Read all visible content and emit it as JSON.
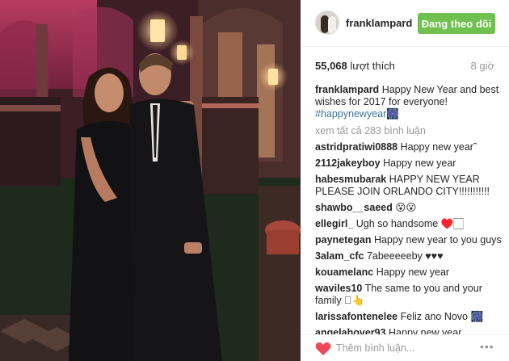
{
  "post": {
    "photo_alt": "Photo"
  },
  "header": {
    "username": "franklampard",
    "follow_label": "Đang theo dõi"
  },
  "stats": {
    "likes_count": "55,068",
    "likes_label": "lượt thích",
    "time_ago": "8 giờ"
  },
  "caption": {
    "username": "franklampard",
    "text": "Happy New Year and best wishes for 2017 for everyone!",
    "hashtag": "#happynewyear",
    "emoji": "🎆"
  },
  "view_all_label": "xem tất cả 283 bình luận",
  "comments": [
    {
      "user": "astridpratiwi0888",
      "text": "Happy new year˜"
    },
    {
      "user": "2112jakeyboy",
      "text": "Happy new year"
    },
    {
      "user": "habesmubarak",
      "text": "HAPPY NEW YEAR PLEASE JOIN ORLANDO CITY!!!!!!!!!!!"
    },
    {
      "user": "shawbo__saeed",
      "text": "😮😮"
    },
    {
      "user": "ellegirl_",
      "text": "Ugh so handsome ♥️🏻"
    },
    {
      "user": "paynetegan",
      "text": "Happy new year to you guys"
    },
    {
      "user": "3alam_cfc",
      "text": "7abeeeeeby ♥♥♥"
    },
    {
      "user": "kouamelanc",
      "text": "Happy new year"
    },
    {
      "user": "waviles10",
      "text": "The same to you and your family 🏻👆"
    },
    {
      "user": "larissafontenelee",
      "text": "Feliz ano Novo 🎆"
    },
    {
      "user": "angelahover93",
      "text": "Happy new year"
    }
  ],
  "add_comment": {
    "placeholder": "Thêm bình luận...",
    "more_label": "•••"
  },
  "colors": {
    "follow_button": "#70c050",
    "hashtag": "#3f729b",
    "heart": "#ed4956",
    "muted": "#999999"
  },
  "icons": {
    "heart": "heart-icon",
    "more": "more-options-icon"
  }
}
